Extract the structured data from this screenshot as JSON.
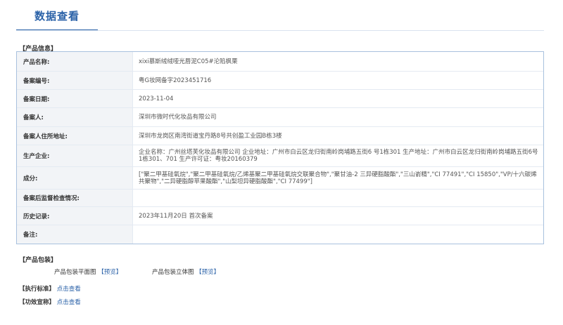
{
  "header": {
    "title": "数据查看"
  },
  "product_info": {
    "section_label": "【产品信息】",
    "rows": [
      {
        "label": "产品名称:",
        "value": "xixi慕斯绒绒哑光唇泥C05#沦陷枫栗"
      },
      {
        "label": "备案编号:",
        "value": "粤G妆网备字2023451716"
      },
      {
        "label": "备案日期:",
        "value": "2023-11-04"
      },
      {
        "label": "备案人:",
        "value": "深圳市微时代化妆品有限公司"
      },
      {
        "label": "备案人住所地址:",
        "value": "深圳市龙岗区南湾街道宝丹路8号共创盈工业园B栋3楼"
      },
      {
        "label": "生产企业:",
        "value": "企业名称：广州丝塔芙化妆品有限公司 企业地址：广州市白云区龙归街南岭岗埔路五街6 号1栋301 生产地址：广州市白云区龙归街南岭岗埔路五街6号1栋301、701 生产许可证：粤妆20160379"
      },
      {
        "label": "成分:",
        "value": "[\"聚二甲基硅氧烷\",\"聚二甲基硅氧烷/乙烯基聚二甲基硅氧烷交联聚合物\",\"聚甘油-2 三异硬脂酸酯\",\"三山嵛精\",\"CI 77491\",\"CI 15850\",\"VP/十六碳烯共聚物\",\"二异硬脂醇苹果酸酯\",\"山梨坦异硬脂酸酯\",\"CI 77499\"]"
      },
      {
        "label": "备案后监督检查情况:",
        "value": ""
      },
      {
        "label": "历史记录:",
        "value": "2023年11月20日 首次备案"
      },
      {
        "label": "备注:",
        "value": ""
      }
    ]
  },
  "packaging": {
    "section_label": "【产品包装】",
    "flat_label": "产品包装平面图",
    "flat_link": "【预览】",
    "stereo_label": "产品包装立体图",
    "stereo_link": "【预览】"
  },
  "standard": {
    "label": "【执行标准】",
    "link": "点击查看"
  },
  "efficacy": {
    "label": "【功效宣称】",
    "link": "点击查看"
  }
}
